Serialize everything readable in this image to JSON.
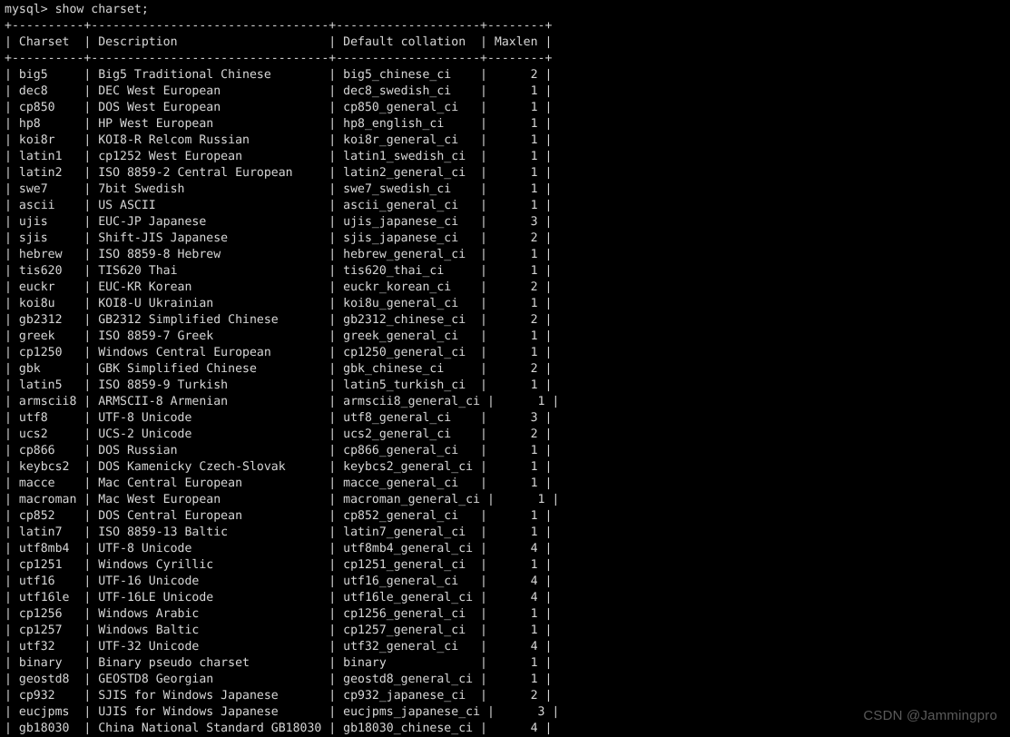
{
  "terminal": {
    "prompt": "mysql>",
    "command": "show charset;",
    "prompt_line": "mysql> show charset;",
    "background_color": "#000000",
    "text_color": "#d6d6d6"
  },
  "watermark": {
    "text": "CSDN @Jammingpro",
    "color": "#5a5a5a"
  },
  "table": {
    "columns": [
      {
        "header": "Charset",
        "width": 10,
        "align": "left"
      },
      {
        "header": "Description",
        "width": 33,
        "align": "left"
      },
      {
        "header": "Default collation",
        "width": 20,
        "align": "left"
      },
      {
        "header": "Maxlen",
        "width": 8,
        "align": "right"
      }
    ],
    "rows": [
      [
        "big5",
        "Big5 Traditional Chinese",
        "big5_chinese_ci",
        "2"
      ],
      [
        "dec8",
        "DEC West European",
        "dec8_swedish_ci",
        "1"
      ],
      [
        "cp850",
        "DOS West European",
        "cp850_general_ci",
        "1"
      ],
      [
        "hp8",
        "HP West European",
        "hp8_english_ci",
        "1"
      ],
      [
        "koi8r",
        "KOI8-R Relcom Russian",
        "koi8r_general_ci",
        "1"
      ],
      [
        "latin1",
        "cp1252 West European",
        "latin1_swedish_ci",
        "1"
      ],
      [
        "latin2",
        "ISO 8859-2 Central European",
        "latin2_general_ci",
        "1"
      ],
      [
        "swe7",
        "7bit Swedish",
        "swe7_swedish_ci",
        "1"
      ],
      [
        "ascii",
        "US ASCII",
        "ascii_general_ci",
        "1"
      ],
      [
        "ujis",
        "EUC-JP Japanese",
        "ujis_japanese_ci",
        "3"
      ],
      [
        "sjis",
        "Shift-JIS Japanese",
        "sjis_japanese_ci",
        "2"
      ],
      [
        "hebrew",
        "ISO 8859-8 Hebrew",
        "hebrew_general_ci",
        "1"
      ],
      [
        "tis620",
        "TIS620 Thai",
        "tis620_thai_ci",
        "1"
      ],
      [
        "euckr",
        "EUC-KR Korean",
        "euckr_korean_ci",
        "2"
      ],
      [
        "koi8u",
        "KOI8-U Ukrainian",
        "koi8u_general_ci",
        "1"
      ],
      [
        "gb2312",
        "GB2312 Simplified Chinese",
        "gb2312_chinese_ci",
        "2"
      ],
      [
        "greek",
        "ISO 8859-7 Greek",
        "greek_general_ci",
        "1"
      ],
      [
        "cp1250",
        "Windows Central European",
        "cp1250_general_ci",
        "1"
      ],
      [
        "gbk",
        "GBK Simplified Chinese",
        "gbk_chinese_ci",
        "2"
      ],
      [
        "latin5",
        "ISO 8859-9 Turkish",
        "latin5_turkish_ci",
        "1"
      ],
      [
        "armscii8",
        "ARMSCII-8 Armenian",
        "armscii8_general_ci",
        "1"
      ],
      [
        "utf8",
        "UTF-8 Unicode",
        "utf8_general_ci",
        "3"
      ],
      [
        "ucs2",
        "UCS-2 Unicode",
        "ucs2_general_ci",
        "2"
      ],
      [
        "cp866",
        "DOS Russian",
        "cp866_general_ci",
        "1"
      ],
      [
        "keybcs2",
        "DOS Kamenicky Czech-Slovak",
        "keybcs2_general_ci",
        "1"
      ],
      [
        "macce",
        "Mac Central European",
        "macce_general_ci",
        "1"
      ],
      [
        "macroman",
        "Mac West European",
        "macroman_general_ci",
        "1"
      ],
      [
        "cp852",
        "DOS Central European",
        "cp852_general_ci",
        "1"
      ],
      [
        "latin7",
        "ISO 8859-13 Baltic",
        "latin7_general_ci",
        "1"
      ],
      [
        "utf8mb4",
        "UTF-8 Unicode",
        "utf8mb4_general_ci",
        "4"
      ],
      [
        "cp1251",
        "Windows Cyrillic",
        "cp1251_general_ci",
        "1"
      ],
      [
        "utf16",
        "UTF-16 Unicode",
        "utf16_general_ci",
        "4"
      ],
      [
        "utf16le",
        "UTF-16LE Unicode",
        "utf16le_general_ci",
        "4"
      ],
      [
        "cp1256",
        "Windows Arabic",
        "cp1256_general_ci",
        "1"
      ],
      [
        "cp1257",
        "Windows Baltic",
        "cp1257_general_ci",
        "1"
      ],
      [
        "utf32",
        "UTF-32 Unicode",
        "utf32_general_ci",
        "4"
      ],
      [
        "binary",
        "Binary pseudo charset",
        "binary",
        "1"
      ],
      [
        "geostd8",
        "GEOSTD8 Georgian",
        "geostd8_general_ci",
        "1"
      ],
      [
        "cp932",
        "SJIS for Windows Japanese",
        "cp932_japanese_ci",
        "2"
      ],
      [
        "eucjpms",
        "UJIS for Windows Japanese",
        "eucjpms_japanese_ci",
        "3"
      ],
      [
        "gb18030",
        "China National Standard GB18030",
        "gb18030_chinese_ci",
        "4"
      ]
    ]
  }
}
